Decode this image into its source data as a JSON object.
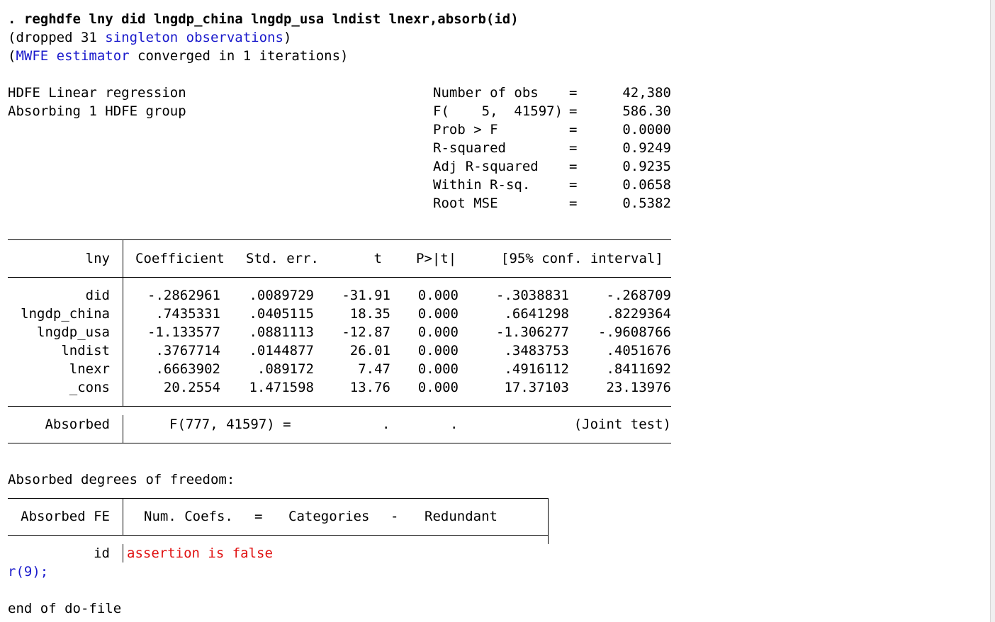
{
  "cmd": {
    "prompt": ". ",
    "command": "reghdfe lny did lngdp_china lngdp_usa lndist lnexr,absorb(id)"
  },
  "notes": {
    "dropped_pre": "(dropped 31 ",
    "dropped_link": "singleton observations",
    "dropped_post": ")",
    "mwfe_pre": "(",
    "mwfe_link": "MWFE estimator",
    "mwfe_post": " converged in 1 iterations)"
  },
  "header": {
    "title1": "HDFE Linear regression",
    "title2": "Absorbing 1 HDFE group",
    "stats": [
      {
        "label": "Number of obs",
        "eq": "=",
        "value": "42,380"
      },
      {
        "label": "F(    5,  41597)",
        "eq": "=",
        "value": "586.30"
      },
      {
        "label": "Prob > F",
        "eq": "=",
        "value": "0.0000"
      },
      {
        "label": "R-squared",
        "eq": "=",
        "value": "0.9249"
      },
      {
        "label": "Adj R-squared",
        "eq": "=",
        "value": "0.9235"
      },
      {
        "label": "Within R-sq.",
        "eq": "=",
        "value": "0.0658"
      },
      {
        "label": "Root MSE",
        "eq": "=",
        "value": "0.5382"
      }
    ]
  },
  "table": {
    "depvar": "lny",
    "columns": {
      "coef": "Coefficient",
      "se": "Std. err.",
      "t": "t",
      "p": "P>|t|",
      "ci": "[95% conf. interval]"
    },
    "rows": [
      {
        "name": "did",
        "coef": "-.2862961",
        "se": ".0089729",
        "t": "-31.91",
        "p": "0.000",
        "lo": "-.3038831",
        "hi": "-.268709"
      },
      {
        "name": "lngdp_china",
        "coef": ".7435331",
        "se": ".0405115",
        "t": "18.35",
        "p": "0.000",
        "lo": ".6641298",
        "hi": ".8229364"
      },
      {
        "name": "lngdp_usa",
        "coef": "-1.133577",
        "se": ".0881113",
        "t": "-12.87",
        "p": "0.000",
        "lo": "-1.306277",
        "hi": "-.9608766"
      },
      {
        "name": "lndist",
        "coef": ".3767714",
        "se": ".0144877",
        "t": "26.01",
        "p": "0.000",
        "lo": ".3483753",
        "hi": ".4051676"
      },
      {
        "name": "lnexr",
        "coef": ".6663902",
        "se": ".089172",
        "t": "7.47",
        "p": "0.000",
        "lo": ".4916112",
        "hi": ".8411692"
      },
      {
        "name": "_cons",
        "coef": "20.2554",
        "se": "1.471598",
        "t": "13.76",
        "p": "0.000",
        "lo": "17.37103",
        "hi": "23.13976"
      }
    ],
    "absorbed": {
      "label": "Absorbed",
      "ftest": "F(777, 41597) =",
      "dot1": ".",
      "dot2": ".",
      "joint": "(Joint test)"
    }
  },
  "dof": {
    "title": "Absorbed degrees of freedom:",
    "col_fe": "Absorbed FE",
    "col_num": "Num. Coefs.",
    "eq": "=",
    "col_cat": "Categories",
    "minus": "-",
    "col_red": "Redundant",
    "row_name": "id",
    "error": "assertion is false"
  },
  "rc": "r(9);",
  "end": "end of do-file"
}
